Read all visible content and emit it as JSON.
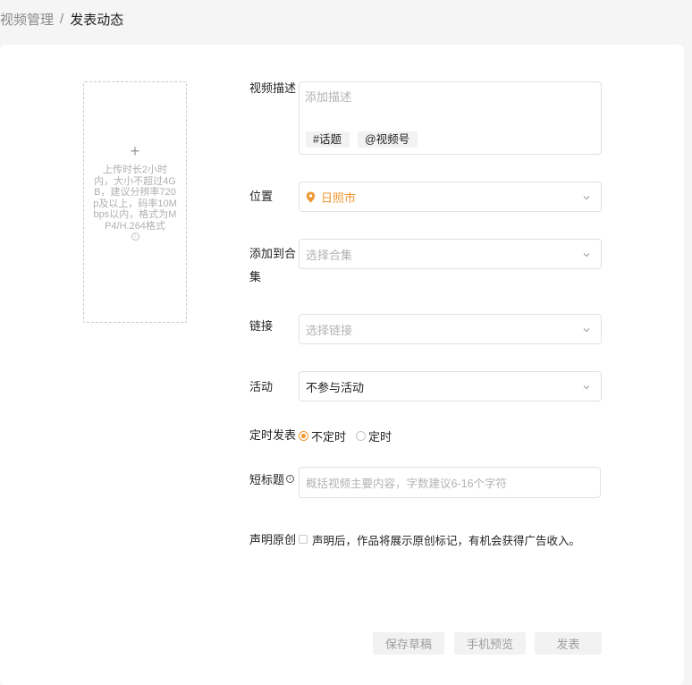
{
  "breadcrumb": {
    "parent": "视频管理",
    "separator": "/",
    "current": "发表动态"
  },
  "upload": {
    "plus": "+",
    "hint": "上传时长2小时内，大小不超过4GB，建议分辨率720p及以上，码率10Mbps以内，格式为MP4/H.264格式",
    "info_icon": "i"
  },
  "form": {
    "description": {
      "label": "视频描述",
      "placeholder": "添加描述",
      "tags": [
        "#话题",
        "@视频号"
      ]
    },
    "location": {
      "label": "位置",
      "value": "日照市"
    },
    "collection": {
      "label": "添加到合集",
      "placeholder": "选择合集"
    },
    "link": {
      "label": "链接",
      "placeholder": "选择链接"
    },
    "activity": {
      "label": "活动",
      "value": "不参与活动"
    },
    "schedule": {
      "label": "定时发表",
      "options": [
        "不定时",
        "定时"
      ],
      "selected": "不定时"
    },
    "short_title": {
      "label": "短标题",
      "info_icon": "i",
      "placeholder": "概括视频主要内容，字数建议6-16个字符"
    },
    "original": {
      "label": "声明原创",
      "text": "声明后，作品将展示原创标记，有机会获得广告收入。"
    }
  },
  "actions": {
    "save_draft": "保存草稿",
    "preview": "手机预览",
    "publish": "发表"
  },
  "colors": {
    "accent": "#f0962e",
    "border": "#e2e2e2",
    "placeholder": "#b3b3b3"
  }
}
